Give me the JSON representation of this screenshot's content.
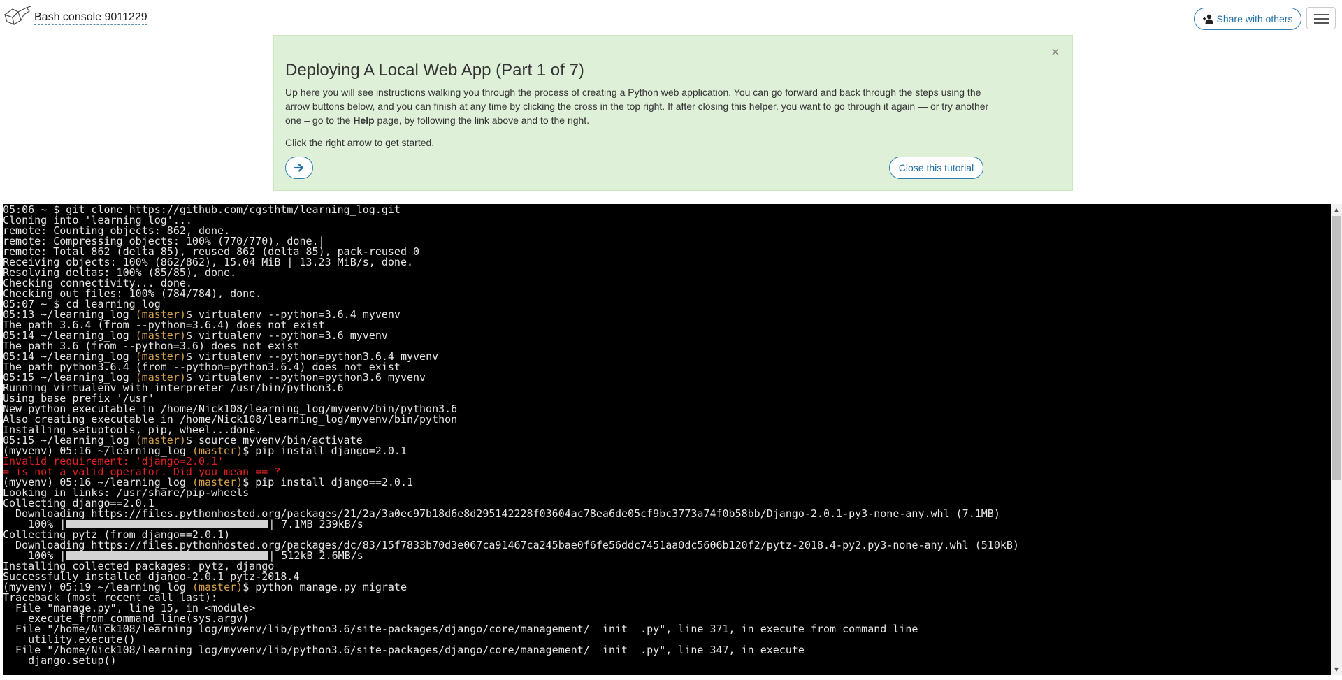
{
  "header": {
    "console_title": "Bash console 9011229",
    "share_label": "Share with others",
    "logo_icon": "pythonanywhere-logo-icon",
    "menu_icon": "hamburger-menu-icon"
  },
  "tutorial": {
    "title": "Deploying A Local Web App (Part 1 of 7)",
    "body_1": "Up here you will see instructions walking you through the process of creating a Python web application. You can go forward and back through the steps using the arrow buttons below, and you can finish at any time by clicking the cross in the top right. If after closing this helper, you want to go through it again — or try another one – go to the ",
    "body_help": "Help",
    "body_2": " page, by following the link above and to the right.",
    "hint": "Click the right arrow to get started.",
    "close_x": "×",
    "next_icon": "arrow-right-icon",
    "close_label": "Close this tutorial",
    "background_color": "#dff0d8"
  },
  "terminal": {
    "colors": {
      "text": "#e6e6e6",
      "branch": "#d4a14a",
      "error": "#e02020",
      "background": "#000000"
    },
    "lines": [
      [
        {
          "t": "05:06 ~ $ git clone https://github.com/cgsthtm/learning_log.git"
        }
      ],
      [
        {
          "t": "Cloning into 'learning_log'..."
        }
      ],
      [
        {
          "t": "remote: Counting objects: 862, done."
        }
      ],
      [
        {
          "t": "remote: Compressing objects: 100% (770/770), done.|"
        }
      ],
      [
        {
          "t": "remote: Total 862 (delta 85), reused 862 (delta 85), pack-reused 0"
        }
      ],
      [
        {
          "t": "Receiving objects: 100% (862/862), 15.04 MiB | 13.23 MiB/s, done."
        }
      ],
      [
        {
          "t": "Resolving deltas: 100% (85/85), done."
        }
      ],
      [
        {
          "t": "Checking connectivity... done."
        }
      ],
      [
        {
          "t": "Checking out files: 100% (784/784), done."
        }
      ],
      [
        {
          "t": "05:07 ~ $ cd learning_log"
        }
      ],
      [
        {
          "t": "05:13 ~/learning_log "
        },
        {
          "t": "(master)",
          "c": "branch"
        },
        {
          "t": "$ virtualenv --python=3.6.4 myvenv"
        }
      ],
      [
        {
          "t": "The path 3.6.4 (from --python=3.6.4) does not exist"
        }
      ],
      [
        {
          "t": "05:14 ~/learning_log "
        },
        {
          "t": "(master)",
          "c": "branch"
        },
        {
          "t": "$ virtualenv --python=3.6 myvenv"
        }
      ],
      [
        {
          "t": "The path 3.6 (from --python=3.6) does not exist"
        }
      ],
      [
        {
          "t": "05:14 ~/learning_log "
        },
        {
          "t": "(master)",
          "c": "branch"
        },
        {
          "t": "$ virtualenv --python=python3.6.4 myvenv"
        }
      ],
      [
        {
          "t": "The path python3.6.4 (from --python=python3.6.4) does not exist"
        }
      ],
      [
        {
          "t": "05:15 ~/learning_log "
        },
        {
          "t": "(master)",
          "c": "branch"
        },
        {
          "t": "$ virtualenv --python=python3.6 myvenv"
        }
      ],
      [
        {
          "t": "Running virtualenv with interpreter /usr/bin/python3.6"
        }
      ],
      [
        {
          "t": "Using base prefix '/usr'"
        }
      ],
      [
        {
          "t": "New python executable in /home/Nick108/learning_log/myvenv/bin/python3.6"
        }
      ],
      [
        {
          "t": "Also creating executable in /home/Nick108/learning_log/myvenv/bin/python"
        }
      ],
      [
        {
          "t": "Installing setuptools, pip, wheel...done."
        }
      ],
      [
        {
          "t": "05:15 ~/learning_log "
        },
        {
          "t": "(master)",
          "c": "branch"
        },
        {
          "t": "$ source myvenv/bin/activate"
        }
      ],
      [
        {
          "t": "(myvenv) 05:16 ~/learning_log "
        },
        {
          "t": "(master)",
          "c": "branch"
        },
        {
          "t": "$ pip install django=2.0.1"
        }
      ],
      [
        {
          "t": "Invalid requirement: 'django=2.0.1'",
          "c": "err"
        }
      ],
      [
        {
          "t": "= is not a valid operator. Did you mean == ?",
          "c": "err"
        }
      ],
      [
        {
          "t": "(myvenv) 05:16 ~/learning_log "
        },
        {
          "t": "(master)",
          "c": "branch"
        },
        {
          "t": "$ pip install django==2.0.1"
        }
      ],
      [
        {
          "t": "Looking in links: /usr/share/pip-wheels"
        }
      ],
      [
        {
          "t": "Collecting django==2.0.1"
        }
      ],
      [
        {
          "t": "  Downloading https://files.pythonhosted.org/packages/21/2a/3a0ec97b18d6e8d295142228f03604ac78ea6de05cf9bc3773a74f0b58bb/Django-2.0.1-py3-none-any.whl (7.1MB)"
        }
      ],
      [
        {
          "t": "    100% |"
        },
        {
          "t": "",
          "c": "bar"
        },
        {
          "t": "| 7.1MB 239kB/s"
        }
      ],
      [
        {
          "t": "Collecting pytz (from django==2.0.1)"
        }
      ],
      [
        {
          "t": "  Downloading https://files.pythonhosted.org/packages/dc/83/15f7833b70d3e067ca91467ca245bae0f6fe56ddc7451aa0dc5606b120f2/pytz-2018.4-py2.py3-none-any.whl (510kB)"
        }
      ],
      [
        {
          "t": "    100% |"
        },
        {
          "t": "",
          "c": "bar"
        },
        {
          "t": "| 512kB 2.6MB/s"
        }
      ],
      [
        {
          "t": "Installing collected packages: pytz, django"
        }
      ],
      [
        {
          "t": "Successfully installed django-2.0.1 pytz-2018.4"
        }
      ],
      [
        {
          "t": "(myvenv) 05:19 ~/learning_log "
        },
        {
          "t": "(master)",
          "c": "branch"
        },
        {
          "t": "$ python manage.py migrate"
        }
      ],
      [
        {
          "t": "Traceback (most recent call last):"
        }
      ],
      [
        {
          "t": "  File \"manage.py\", line 15, in <module>"
        }
      ],
      [
        {
          "t": "    execute_from_command_line(sys.argv)"
        }
      ],
      [
        {
          "t": "  File \"/home/Nick108/learning_log/myvenv/lib/python3.6/site-packages/django/core/management/__init__.py\", line 371, in execute_from_command_line"
        }
      ],
      [
        {
          "t": "    utility.execute()"
        }
      ],
      [
        {
          "t": "  File \"/home/Nick108/learning_log/myvenv/lib/python3.6/site-packages/django/core/management/__init__.py\", line 347, in execute"
        }
      ],
      [
        {
          "t": "    django.setup()"
        }
      ]
    ],
    "progress_bars": [
      1.0,
      1.0
    ]
  },
  "scrollbar": {
    "up_icon": "scroll-up-arrow-icon",
    "down_icon": "scroll-down-arrow-icon"
  }
}
